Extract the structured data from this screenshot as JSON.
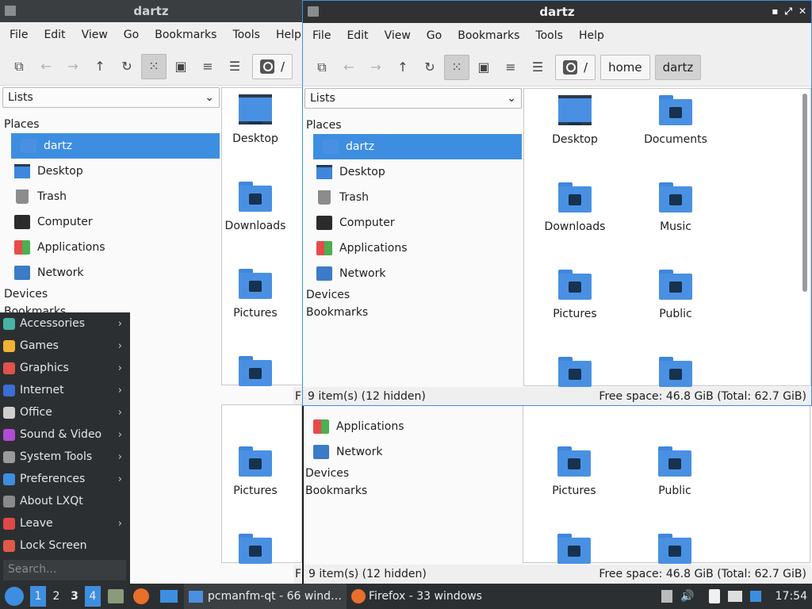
{
  "window_title": "dartz",
  "menu": [
    "File",
    "Edit",
    "View",
    "Go",
    "Bookmarks",
    "Tools",
    "Help"
  ],
  "path": {
    "root": "/",
    "home": "home",
    "current": "dartz"
  },
  "side_combo": "Lists",
  "places_label": "Places",
  "places": [
    "dartz",
    "Desktop",
    "Trash",
    "Computer",
    "Applications",
    "Network"
  ],
  "devices_label": "Devices",
  "bookmarks_label": "Bookmarks",
  "files": [
    "Desktop",
    "Documents",
    "Downloads",
    "Music",
    "Pictures",
    "Public"
  ],
  "status": {
    "items": "9 item(s) (12 hidden)",
    "space": "Free space: 46.8 GiB (Total: 62.7 GiB)",
    "clipped": "F"
  },
  "start_menu": {
    "items": [
      {
        "label": "Accessories",
        "arrow": true,
        "color": "#46b3a6"
      },
      {
        "label": "Games",
        "arrow": true,
        "color": "#f2b233"
      },
      {
        "label": "Graphics",
        "arrow": true,
        "color": "#e0524b"
      },
      {
        "label": "Internet",
        "arrow": true,
        "color": "#3b6ed6"
      },
      {
        "label": "Office",
        "arrow": true,
        "color": "#cfcfcf"
      },
      {
        "label": "Sound & Video",
        "arrow": true,
        "color": "#b04bd6"
      },
      {
        "label": "System Tools",
        "arrow": true,
        "color": "#9a9a9a"
      },
      {
        "label": "Preferences",
        "arrow": true,
        "color": "#3d8ee0"
      },
      {
        "label": "About LXQt",
        "arrow": false,
        "color": "#8a8a8a"
      },
      {
        "label": "Leave",
        "arrow": true,
        "color": "#e04848"
      },
      {
        "label": "Lock Screen",
        "arrow": false,
        "color": "#e05a48"
      }
    ],
    "search_placeholder": "Search..."
  },
  "taskbar": {
    "workspaces": [
      "1",
      "2",
      "3",
      "4"
    ],
    "task1": "pcmanfm-qt - 66 wind…",
    "task2": "Firefox - 33 windows",
    "clock": "17:54"
  },
  "colors": {
    "accent": "#3d8ee0",
    "folder": "#4a90e2",
    "panel": "#2c2f31"
  }
}
